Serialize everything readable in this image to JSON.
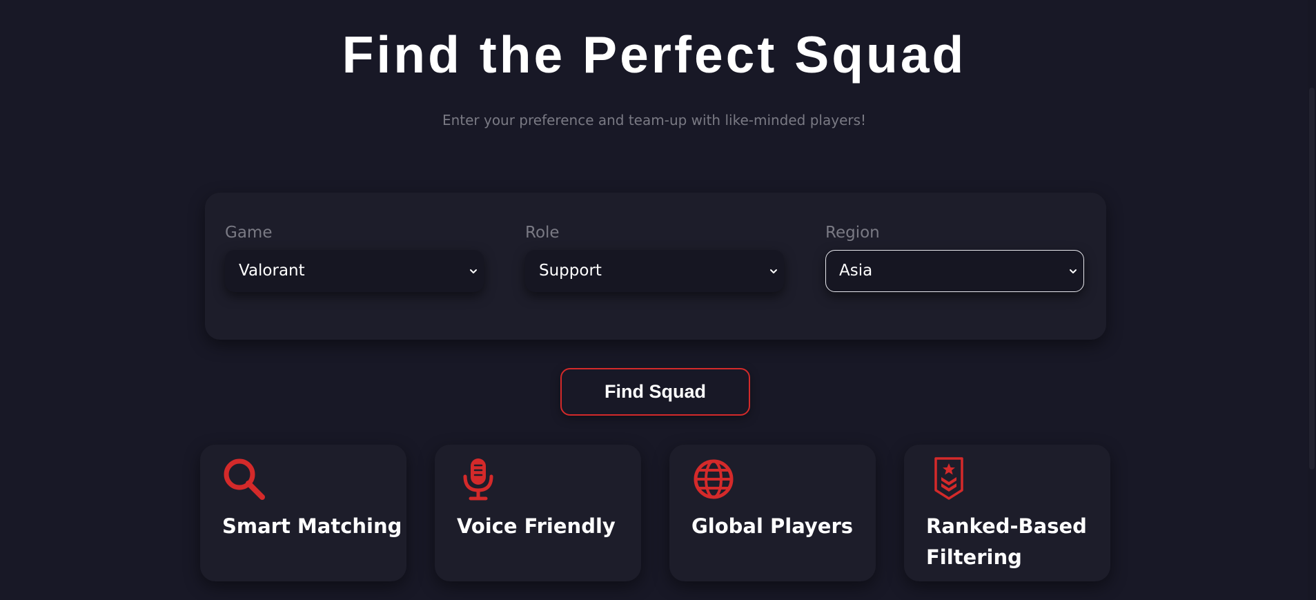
{
  "hero": {
    "title": "Find the Perfect Squad",
    "subtitle": "Enter your preference and team-up with like-minded players!"
  },
  "form": {
    "fields": [
      {
        "label": "Game",
        "value": "Valorant"
      },
      {
        "label": "Role",
        "value": "Support"
      },
      {
        "label": "Region",
        "value": "Asia"
      }
    ],
    "submit_label": "Find Squad"
  },
  "features": [
    {
      "title": "Smart Matching",
      "icon": "search-icon"
    },
    {
      "title": "Voice Friendly",
      "icon": "microphone-icon"
    },
    {
      "title": "Global Players",
      "icon": "globe-icon"
    },
    {
      "title": "Ranked-Based Filtering",
      "icon": "rank-badge-icon"
    }
  ],
  "colors": {
    "background": "#181826",
    "card": "#1d1d2a",
    "accent": "#d42a2a",
    "muted_text": "#7a7a84"
  }
}
